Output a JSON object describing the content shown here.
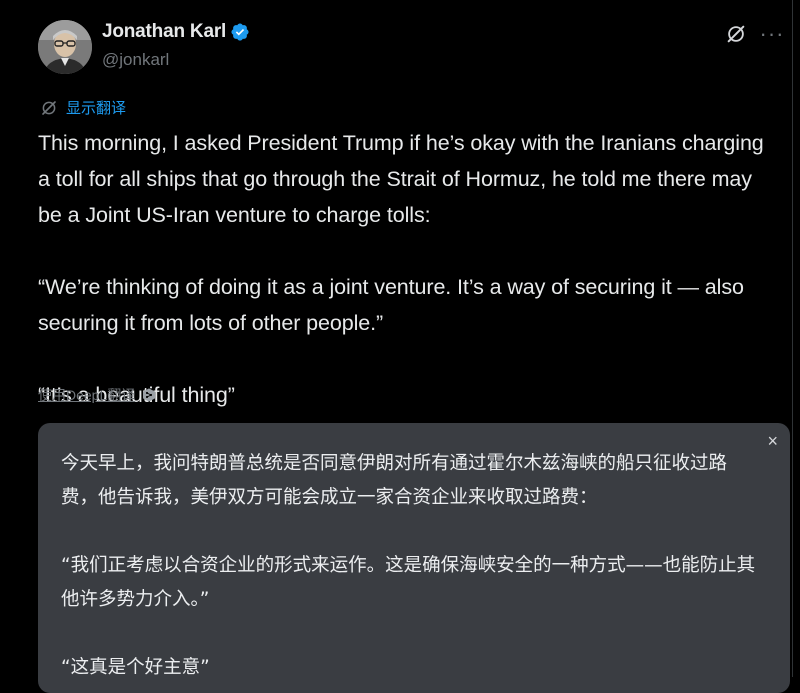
{
  "author": {
    "display_name": "Jonathan Karl",
    "handle": "@jonkarl",
    "verified": true
  },
  "actions": {
    "show_translation": "显示翻译",
    "translate_deepl": "使用DeepL翻译"
  },
  "tweet": {
    "paragraphs": [
      "This morning, I asked President Trump if he’s okay with the Iranians charging a toll for all ships that go through the Strait of Hormuz, he told me there may be a Joint US-Iran venture to charge tolls:",
      "“We’re thinking of doing it as a joint venture. It’s a way of securing it — also securing it from lots of other people.”",
      "“It’s a beautiful thing”"
    ]
  },
  "translation": {
    "close_label": "×",
    "paragraphs": [
      "今天早上，我问特朗普总统是否同意伊朗对所有通过霍尔木兹海峡的船只征收过路费，他告诉我，美伊双方可能会成立一家合资企业来收取过路费：",
      "“我们正考虑以合资企业的形式来运作。这是确保海峡安全的一种方式——也能防止其他许多势力介入。”",
      "“这真是个好主意”"
    ]
  },
  "icons": {
    "verified": "verified-badge-icon",
    "translate": "translate-icon",
    "grok": "grok-icon",
    "more": "more-icon",
    "deepl": "deepl-icon"
  },
  "colors": {
    "background": "#000000",
    "text": "#e7e9ea",
    "secondary": "#71767b",
    "accent": "#1d9bf0",
    "translation_bg": "#3a3d42"
  }
}
